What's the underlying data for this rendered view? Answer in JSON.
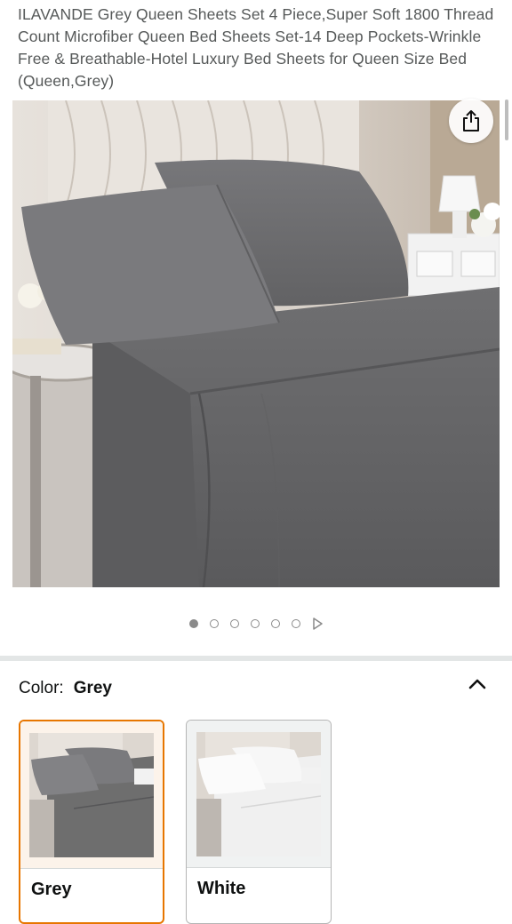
{
  "product": {
    "title": "ILAVANDE Grey Queen Sheets Set 4 Piece,Super Soft 1800 Thread Count Microfiber Queen Bed Sheets Set-14 Deep Pockets-Wrinkle Free & Breathable-Hotel Luxury Bed Sheets for Queen Size Bed (Queen,Grey)"
  },
  "gallery": {
    "image_description_icon": "bed-with-grey-sheets-image",
    "share_icon": "share-icon",
    "pagination": {
      "total_dots": 6,
      "active_index": 0,
      "next_icon": "play-triangle-icon"
    }
  },
  "variation": {
    "label": "Color:",
    "selected_value": "Grey",
    "collapse_icon": "chevron-up-icon",
    "options": [
      {
        "label": "Grey",
        "selected": true,
        "sheet_color": "#6e6e6e"
      },
      {
        "label": "White",
        "selected": false,
        "sheet_color": "#f2f2f2"
      }
    ]
  },
  "colors": {
    "selected_border": "#e77600",
    "title_text": "#565959",
    "divider": "#e3e6e6"
  }
}
